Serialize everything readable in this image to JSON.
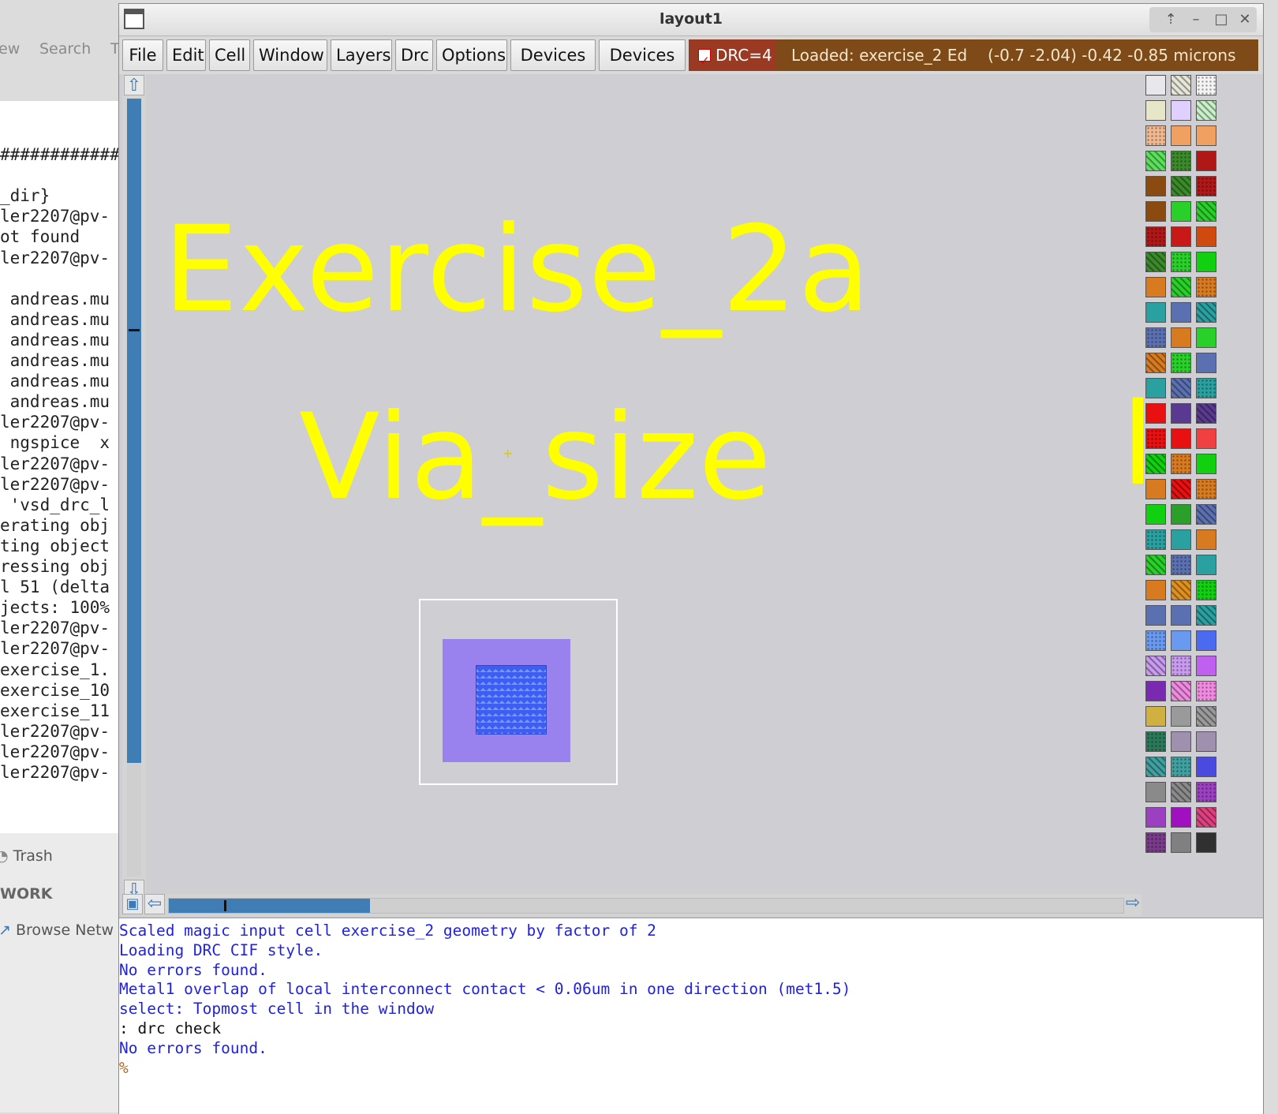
{
  "background": {
    "file_manager_toolbar": [
      "ew",
      "Search",
      "T"
    ],
    "terminal_lines": [
      "###############",
      "",
      "_dir}",
      "ler2207@pv-",
      "ot found",
      "ler2207@pv-",
      "",
      " andreas.mu",
      " andreas.mu",
      " andreas.mu",
      " andreas.mu",
      " andreas.mu",
      " andreas.mu",
      "ler2207@pv-",
      " ngspice  x",
      "ler2207@pv-",
      "ler2207@pv-",
      " 'vsd_drc_l",
      "erating obj",
      "ting object",
      "ressing obj",
      "l 51 (delta",
      "jects: 100%",
      "ler2207@pv-",
      "ler2207@pv-",
      "exercise_1.",
      "exercise_10",
      "exercise_11",
      "ler2207@pv-",
      "ler2207@pv-",
      "ler2207@pv-"
    ],
    "sidebar": {
      "trash": "Trash",
      "network_header": "WORK",
      "browse_network": "Browse Netw"
    }
  },
  "window": {
    "title": "layout1",
    "controls": [
      "⇡",
      "–",
      "□",
      "✕"
    ]
  },
  "menu": {
    "file": "File",
    "edit": "Edit",
    "cell": "Cell",
    "window": "Window",
    "layers": "Layers",
    "drc": "Drc",
    "options": "Options",
    "devices1": "Devices 1",
    "devices2": "Devices 2"
  },
  "drc_indicator": {
    "label": "DRC=4",
    "checked": true,
    "color": "#9a3a22"
  },
  "status": {
    "loaded": "Loaded: exercise_2 Ed",
    "coords": "(-0.7 -2.04) -0.42 -0.85 microns",
    "color": "#7e4a18"
  },
  "layout": {
    "labels": {
      "title": "Exercise_2a",
      "subtitle": "Via_size",
      "partial": "M"
    },
    "label_color": "#ffff00",
    "metal1_color": "#9a82ee",
    "via_color": "#3f5df0"
  },
  "palette": {
    "swatches": [
      [
        "#e8e8ec",
        "#e6e6d8",
        "#f4f4f4"
      ],
      [
        "#e8e6c8",
        "#e0d0ff",
        "#c8f0c8"
      ],
      [
        "#f0b890",
        "#f0a060",
        "#f0a060"
      ],
      [
        "#5ae05a",
        "#3a8a2a",
        "#b01818"
      ],
      [
        "#8a4a10",
        "#3a8a2a",
        "#b01818"
      ],
      [
        "#8a4a10",
        "#2ad02a",
        "#2ad02a"
      ],
      [
        "#b01818",
        "#c81818",
        "#d04a10"
      ],
      [
        "#3a8a2a",
        "#2ad02a",
        "#10d010"
      ],
      [
        "#d87a20",
        "#2ad02a",
        "#d87a20"
      ],
      [
        "#2aa0a0",
        "#5a70b0",
        "#2aa0a0"
      ],
      [
        "#5a70b0",
        "#d87a20",
        "#2ad02a"
      ],
      [
        "#d87a20",
        "#2ad02a",
        "#5a70b0"
      ],
      [
        "#2aa0a0",
        "#5a70b0",
        "#2aa0a0"
      ],
      [
        "#e81010",
        "#5a3a90",
        "#5a3a90"
      ],
      [
        "#e81010",
        "#e81010",
        "#f04040"
      ],
      [
        "#10d010",
        "#d87a20",
        "#10d010"
      ],
      [
        "#d87a20",
        "#e81010",
        "#d87a20"
      ],
      [
        "#10d010",
        "#2aa02a",
        "#5a70b0"
      ],
      [
        "#2aa0a0",
        "#2aa0a0",
        "#d87a20"
      ],
      [
        "#2ad02a",
        "#5a70b0",
        "#2aa0a0"
      ],
      [
        "#d87a20",
        "#e09020",
        "#10d010"
      ],
      [
        "#5a70b0",
        "#5a70b0",
        "#2aa0a0"
      ],
      [
        "#6a9af0",
        "#6a9af0",
        "#4a6af0"
      ],
      [
        "#c89af0",
        "#c89af0",
        "#c060f0"
      ],
      [
        "#7a2ab0",
        "#f08ae0",
        "#f08ae0"
      ],
      [
        "#d0b040",
        "#9a9a9a",
        "#9a9a9a"
      ],
      [
        "#2a7a5a",
        "#a090b0",
        "#a090b0"
      ],
      [
        "#40a0a0",
        "#40a0a0",
        "#4a4ae0"
      ],
      [
        "#8a8a8a",
        "#8a8a8a",
        "#9a40c0"
      ],
      [
        "#9a40c0",
        "#a010c0",
        "#e04080"
      ],
      [
        "#7a3a8a",
        "#808080",
        "#303030"
      ]
    ]
  },
  "console": {
    "lines": [
      {
        "text": "Scaled magic input cell exercise_2 geometry by factor of 2",
        "color": "blue"
      },
      {
        "text": "Loading DRC CIF style.",
        "color": "blue"
      },
      {
        "text": "No errors found.",
        "color": "blue"
      },
      {
        "text": "Metal1 overlap of local interconnect contact < 0.06um in one direction (met1.5)",
        "color": "blue"
      },
      {
        "text": "select: Topmost cell in the window",
        "color": "blue"
      },
      {
        "text": ": drc check",
        "color": "black"
      },
      {
        "text": "No errors found.",
        "color": "blue"
      },
      {
        "text": "%",
        "color": "brown"
      }
    ]
  }
}
